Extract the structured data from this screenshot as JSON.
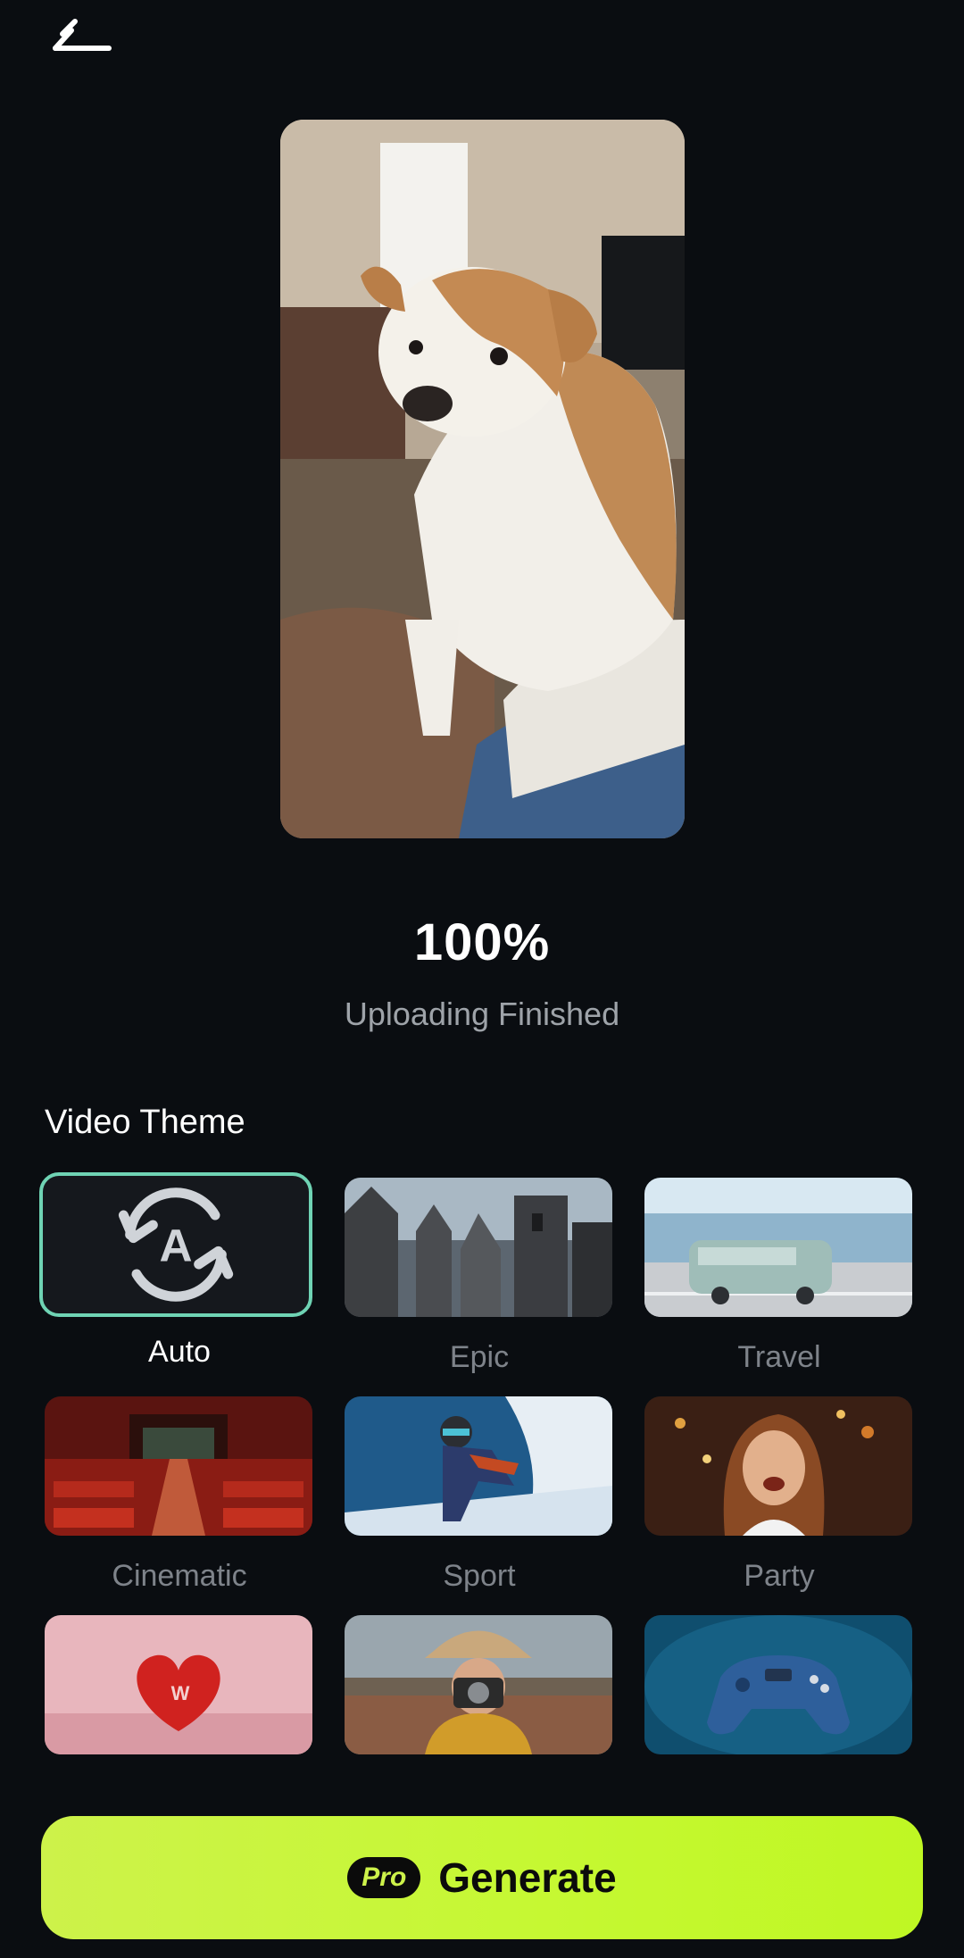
{
  "progress": {
    "percent_text": "100%",
    "status": "Uploading Finished"
  },
  "video_theme": {
    "title": "Video Theme",
    "selected": "Auto",
    "themes": [
      {
        "label": "Auto"
      },
      {
        "label": "Epic"
      },
      {
        "label": "Travel"
      },
      {
        "label": "Cinematic"
      },
      {
        "label": "Sport"
      },
      {
        "label": "Party"
      },
      {
        "label": ""
      },
      {
        "label": ""
      },
      {
        "label": ""
      }
    ]
  },
  "generate": {
    "badge": "Pro",
    "label": "Generate"
  },
  "colors": {
    "accent": "#c6f833",
    "selected_border": "#6fd3b4",
    "background": "#0a0d11"
  },
  "icons": {
    "back": "back-arrow-icon",
    "auto": "auto-refresh-icon"
  }
}
